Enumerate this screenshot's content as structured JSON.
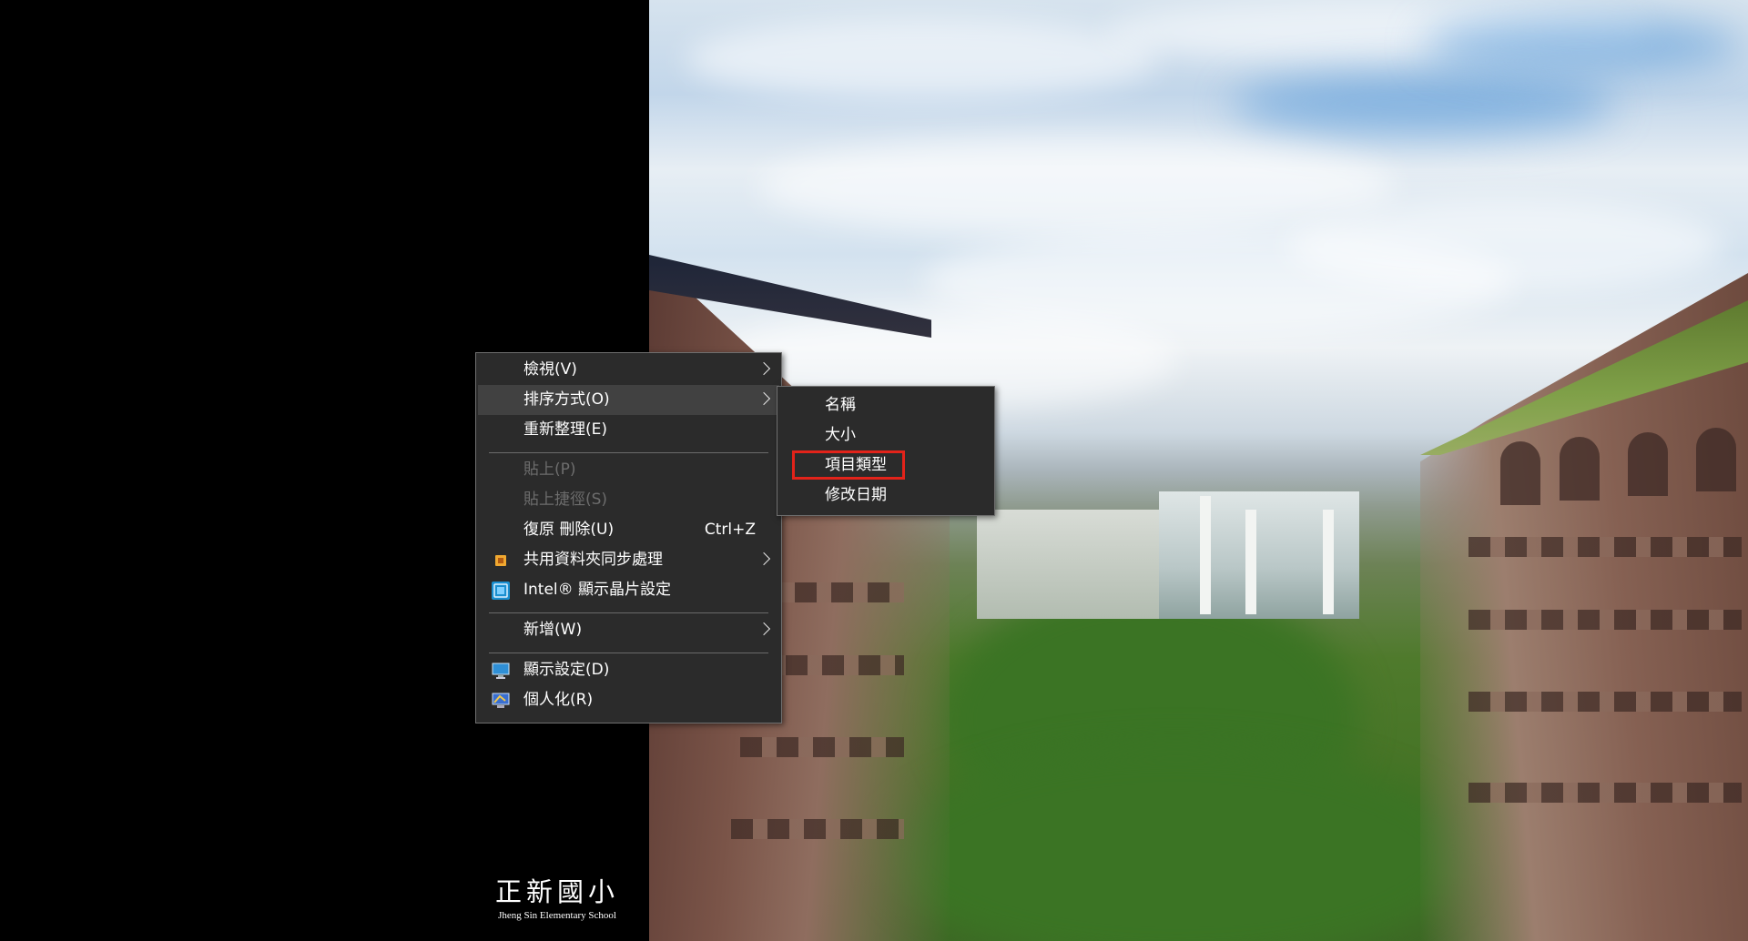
{
  "logo": {
    "main": "正新國小",
    "sub": "Jheng Sin Elementary School"
  },
  "context_menu": {
    "items": [
      {
        "label": "檢視(V)",
        "submenu": true
      },
      {
        "label": "排序方式(O)",
        "submenu": true,
        "highlighted": true
      },
      {
        "label": "重新整理(E)"
      },
      {
        "label": "貼上(P)",
        "disabled": true
      },
      {
        "label": "貼上捷徑(S)",
        "disabled": true
      },
      {
        "label": "復原 刪除(U)",
        "shortcut": "Ctrl+Z"
      },
      {
        "label": "共用資料夾同步處理",
        "submenu": true,
        "icon": "sync-folder-icon"
      },
      {
        "label": "Intel® 顯示晶片設定",
        "icon": "intel-graphics-icon"
      },
      {
        "label": "新增(W)",
        "submenu": true
      },
      {
        "label": "顯示設定(D)",
        "icon": "display-settings-icon"
      },
      {
        "label": "個人化(R)",
        "icon": "personalize-icon"
      }
    ]
  },
  "sort_submenu": {
    "items": [
      {
        "label": "名稱"
      },
      {
        "label": "大小"
      },
      {
        "label": "項目類型",
        "annotated": true
      },
      {
        "label": "修改日期"
      }
    ]
  },
  "colors": {
    "menu_bg": "#2b2b2b",
    "menu_highlight": "#414141",
    "annotation": "#e2231a"
  }
}
